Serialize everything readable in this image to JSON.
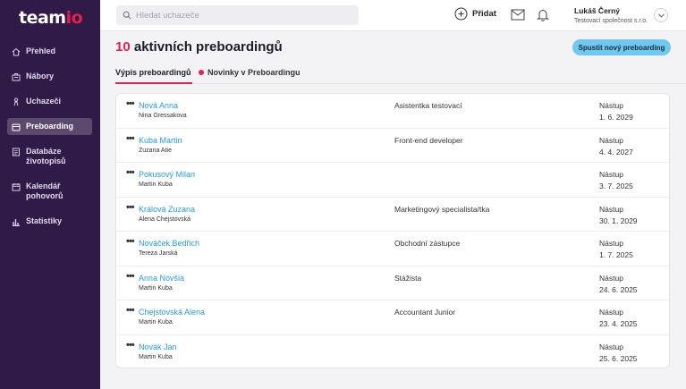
{
  "logo": {
    "main": "team",
    "accent": "io"
  },
  "sidebar": {
    "items": [
      {
        "label": "Přehled",
        "icon": "home-icon",
        "active": false
      },
      {
        "label": "Nábory",
        "icon": "briefcase-icon",
        "active": false
      },
      {
        "label": "Uchazeči",
        "icon": "person-icon",
        "active": false
      },
      {
        "label": "Preboarding",
        "icon": "folder-icon",
        "active": true
      },
      {
        "label": "Databáze životopisů",
        "icon": "document-icon",
        "active": false
      },
      {
        "label": "Kalendář pohovorů",
        "icon": "calendar-icon",
        "active": false
      },
      {
        "label": "Statistiky",
        "icon": "bar-chart-icon",
        "active": false
      }
    ]
  },
  "search": {
    "placeholder": "Hledat uchazeče",
    "value": ""
  },
  "header": {
    "add_label": "Přidat",
    "user_name": "Lukáš Černý",
    "user_company": "Testovací společnost s.r.o."
  },
  "main": {
    "title_count": "10",
    "title_text": "aktivních preboardingů",
    "start_button": "Spustit nový preboarding",
    "tabs": [
      {
        "label": "Výpis preboardingů",
        "active": true
      },
      {
        "label": "Novinky v Preboardingu",
        "active": false
      }
    ],
    "start_label": "Nástup",
    "rows": [
      {
        "name": "Nová Anna",
        "owner": "Nina Gressakova",
        "position": "Asistentka testovací",
        "date": "1. 6. 2029"
      },
      {
        "name": "Kuba Martin",
        "owner": "Zuzana Atie",
        "position": "Front-end developer",
        "date": "4. 4. 2027"
      },
      {
        "name": "Pokusový Milan",
        "owner": "Martin Kuba",
        "position": "",
        "date": "3. 7. 2025"
      },
      {
        "name": "Králová Zuzana",
        "owner": "Alena Chejstovská",
        "position": "Marketingový specialista/tka",
        "date": "30. 1. 2029"
      },
      {
        "name": "Nováček Bedřich",
        "owner": "Tereza Jarská",
        "position": "Obchodní zástupce",
        "date": "1. 7. 2025"
      },
      {
        "name": "Anna Novšia",
        "owner": "Martin Kuba",
        "position": "Stážista",
        "date": "24. 6. 2025"
      },
      {
        "name": "Chejstovská Alena",
        "owner": "Martin Kuba",
        "position": "Accountant Junior",
        "date": "23. 4. 2025"
      },
      {
        "name": "Novák Jan",
        "owner": "Martin Kuba",
        "position": "",
        "date": "25. 6. 2025"
      }
    ]
  },
  "colors": {
    "sidebar_bg": "#2f1a48",
    "accent": "#e8204f",
    "link": "#2a9ad8",
    "button": "#6ec8f0"
  }
}
